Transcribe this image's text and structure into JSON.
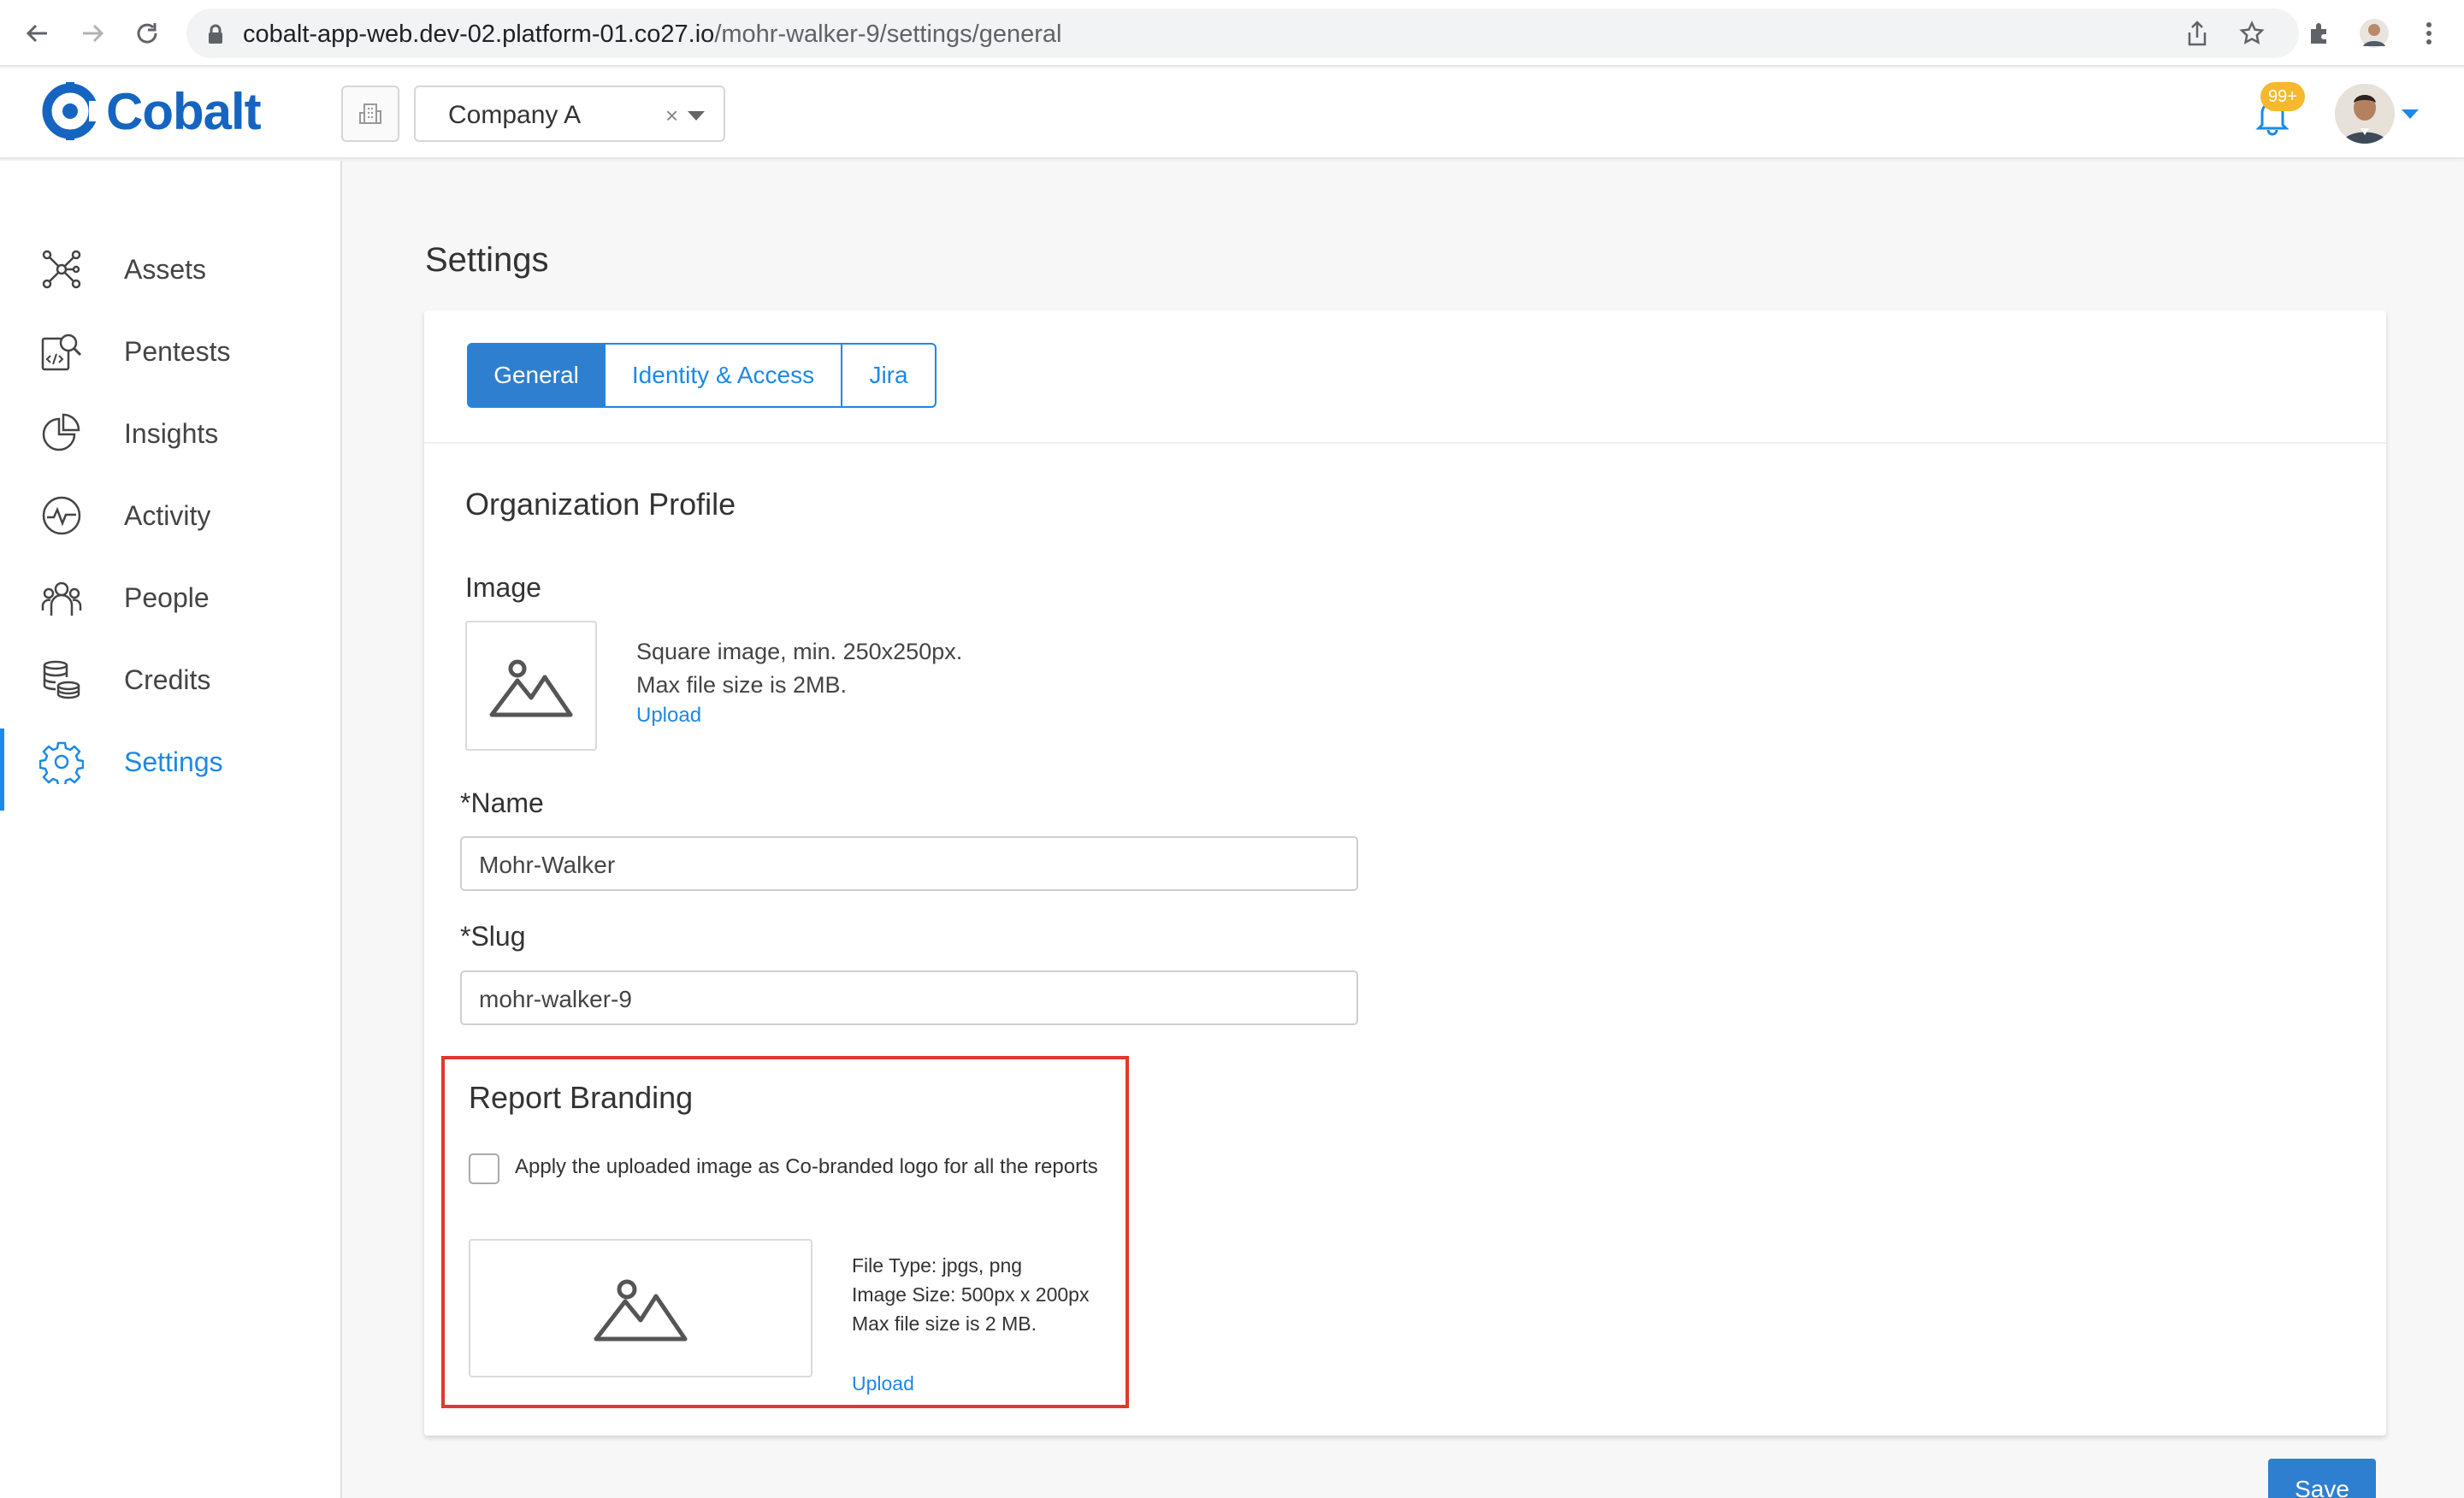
{
  "browser": {
    "url_host": "cobalt-app-web.dev-02.platform-01.co27.io",
    "url_path": "/mohr-walker-9/settings/general"
  },
  "header": {
    "logo_text": "Cobalt",
    "org_selector": {
      "value": "Company A",
      "clear": "×"
    },
    "notifications_badge": "99+"
  },
  "sidebar": {
    "items": [
      {
        "label": "Assets",
        "icon": "assets-network-icon"
      },
      {
        "label": "Pentests",
        "icon": "pentests-icon"
      },
      {
        "label": "Insights",
        "icon": "insights-pie-icon"
      },
      {
        "label": "Activity",
        "icon": "activity-pulse-icon"
      },
      {
        "label": "People",
        "icon": "people-icon"
      },
      {
        "label": "Credits",
        "icon": "credits-coins-icon"
      },
      {
        "label": "Settings",
        "icon": "gear-icon",
        "active": true
      }
    ]
  },
  "main": {
    "page_title": "Settings",
    "tabs": [
      {
        "label": "General",
        "active": true
      },
      {
        "label": "Identity & Access"
      },
      {
        "label": "Jira"
      }
    ],
    "org_profile": {
      "title": "Organization Profile",
      "image_label": "Image",
      "image_hint_1": "Square image, min. 250x250px.",
      "image_hint_2": "Max file size is 2MB.",
      "upload": "Upload",
      "name_label": "*Name",
      "name_value": "Mohr-Walker",
      "slug_label": "*Slug",
      "slug_value": "mohr-walker-9"
    },
    "report_branding": {
      "title": "Report Branding",
      "checkbox_label": "Apply the uploaded image as Co-branded logo for all the reports",
      "checked": false,
      "file_type": "File Type: jpgs, png",
      "image_size": "Image Size: 500px x 200px",
      "max_size": "Max file size is 2 MB.",
      "upload": "Upload"
    },
    "save_label": "Save"
  },
  "colors": {
    "accent": "#1e88e5",
    "primary_button": "#2f7fd0",
    "highlight_border": "#e0392b",
    "badge": "#f5b82e"
  }
}
